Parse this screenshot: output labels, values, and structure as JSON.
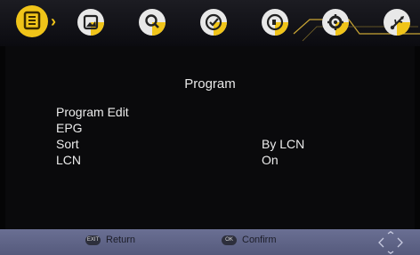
{
  "menu": {
    "tabs": [
      {
        "icon": "program-icon",
        "active": true
      },
      {
        "icon": "picture-icon",
        "active": false
      },
      {
        "icon": "search-icon",
        "active": false
      },
      {
        "icon": "clock-icon",
        "active": false
      },
      {
        "icon": "sound-icon",
        "active": false
      },
      {
        "icon": "gear-icon",
        "active": false
      },
      {
        "icon": "usb-icon",
        "active": false
      }
    ],
    "accent_color": "#f0c419"
  },
  "panel": {
    "title": "Program",
    "options": [
      {
        "label": "Program Edit",
        "value": ""
      },
      {
        "label": "EPG",
        "value": ""
      },
      {
        "label": "Sort",
        "value": "By LCN"
      },
      {
        "label": "LCN",
        "value": "On"
      }
    ]
  },
  "help": {
    "return_key": "EXIT",
    "return_label": "Return",
    "confirm_key": "OK",
    "confirm_label": "Confirm"
  },
  "colors": {
    "bottom_bar": "#60658a",
    "background": "#050506"
  }
}
